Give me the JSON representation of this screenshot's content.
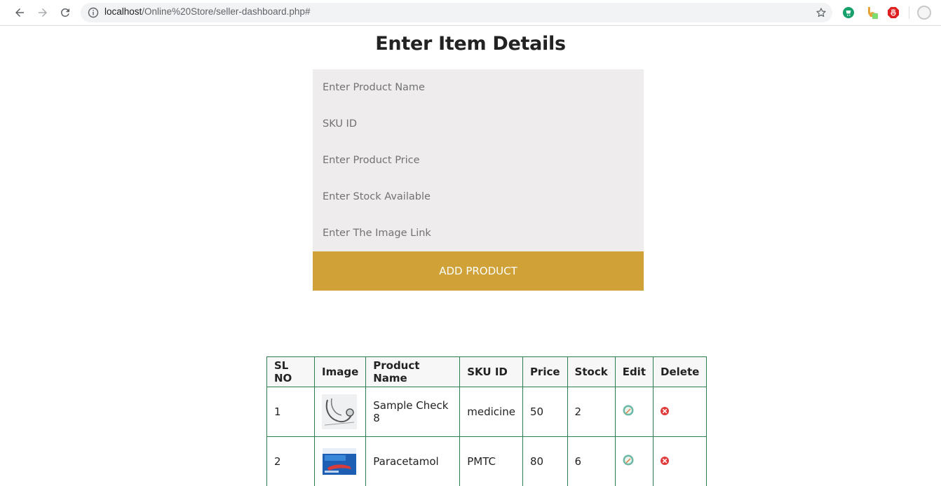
{
  "browser": {
    "url_host": "localhost",
    "url_path": "/Online%20Store/seller-dashboard.php#"
  },
  "page": {
    "title": "Enter Item Details"
  },
  "form": {
    "product_name_placeholder": "Enter Product Name",
    "sku_placeholder": "SKU ID",
    "price_placeholder": "Enter Product Price",
    "stock_placeholder": "Enter Stock Available",
    "image_link_placeholder": "Enter The Image Link",
    "submit_label": "ADD PRODUCT"
  },
  "table": {
    "headers": [
      "SL NO",
      "Image",
      "Product Name",
      "SKU ID",
      "Price",
      "Stock",
      "Edit",
      "Delete"
    ],
    "rows": [
      {
        "sl_no": "1",
        "image": "stethoscope-thumbnail",
        "product_name": "Sample Check 8",
        "sku_id": "medicine",
        "price": "50",
        "stock": "2"
      },
      {
        "sl_no": "2",
        "image": "paracetamol-box-thumbnail",
        "product_name": "Paracetamol",
        "sku_id": "PMTC",
        "price": "80",
        "stock": "6"
      }
    ]
  },
  "colors": {
    "button": "#cfa136",
    "field_bg": "#eeecec",
    "table_border": "#2e7d4f",
    "delete": "#e03c3c"
  }
}
